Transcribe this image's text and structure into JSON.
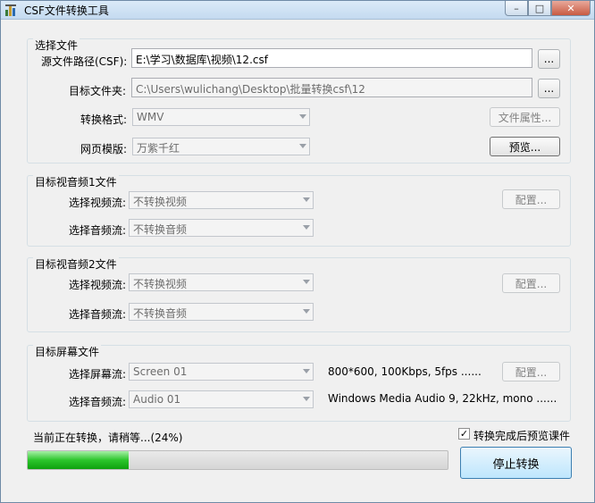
{
  "window": {
    "title": "CSF文件转换工具",
    "minimize": "–",
    "maximize": "□",
    "close": "✕"
  },
  "source_group": {
    "title": "选择文件",
    "source_label": "源文件路径(CSF):",
    "source_value": "E:\\学习\\数据库\\视频\\12.csf",
    "browse1": "...",
    "target_label": "目标文件夹:",
    "target_value": "C:\\Users\\wulichang\\Desktop\\批量转换csf\\12",
    "browse2": "...",
    "format_label": "转换格式:",
    "format_value": "WMV",
    "file_props": "文件属性...",
    "template_label": "网页模版:",
    "template_value": "万紫千红",
    "preview": "预览..."
  },
  "av1": {
    "title": "目标视音频1文件",
    "video_label": "选择视频流:",
    "video_value": "不转换视频",
    "audio_label": "选择音频流:",
    "audio_value": "不转换音频",
    "config": "配置..."
  },
  "av2": {
    "title": "目标视音频2文件",
    "video_label": "选择视频流:",
    "video_value": "不转换视频",
    "audio_label": "选择音频流:",
    "audio_value": "不转换音频",
    "config": "配置..."
  },
  "screen": {
    "title": "目标屏幕文件",
    "screen_label": "选择屏幕流:",
    "screen_value": "Screen 01",
    "screen_info": "800*600, 100Kbps, 5fps ......",
    "config": "配置...",
    "audio_label": "选择音频流:",
    "audio_value": "Audio 01",
    "audio_info": "Windows Media Audio 9, 22kHz, mono ......"
  },
  "status": {
    "text": "当前正在转换，请稍等...(24%)",
    "progress": 0.24,
    "preview_after_label": "转换完成后预览课件",
    "preview_after_checked": true,
    "stop": "停止转换"
  }
}
